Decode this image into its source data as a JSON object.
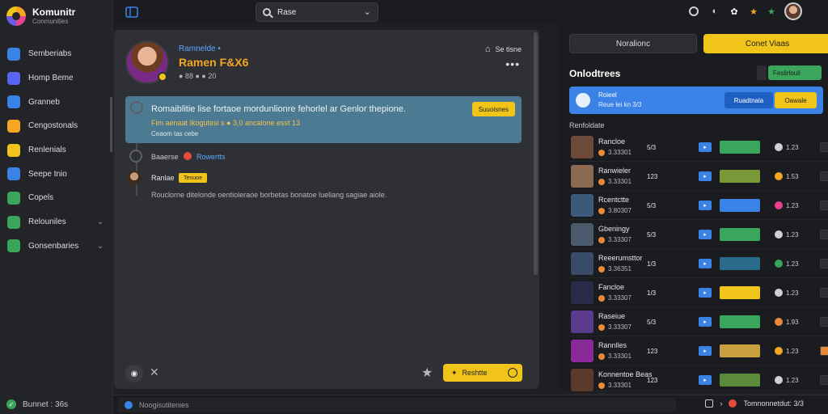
{
  "app": {
    "title": "Komunitr",
    "subtitle": "Conmunities"
  },
  "sidebar": {
    "items": [
      {
        "label": "Semberiabs",
        "icon": "chat-icon",
        "color": "#3b82e6",
        "chevron": false
      },
      {
        "label": "Homp Beme",
        "icon": "home-icon",
        "color": "#5865f2",
        "chevron": false
      },
      {
        "label": "Granneb",
        "icon": "star-icon",
        "color": "#3b82e6",
        "chevron": false
      },
      {
        "label": "Cengostonals",
        "icon": "folder-icon",
        "color": "#f5a623",
        "chevron": false
      },
      {
        "label": "Renlenials",
        "icon": "smile-icon",
        "color": "#f0c419",
        "chevron": false
      },
      {
        "label": "Seepe tnio",
        "icon": "info-icon",
        "color": "#3b82e6",
        "chevron": false
      },
      {
        "label": "Copels",
        "icon": "gamepad-icon",
        "color": "#3ba55c",
        "chevron": false
      },
      {
        "label": "Relouniles",
        "icon": "xbox-icon",
        "color": "#3ba55c",
        "chevron": true
      },
      {
        "label": "Gonsenbaries",
        "icon": "grid-icon",
        "color": "#3ba55c",
        "chevron": true
      }
    ],
    "footer": "Bunnet : 36s"
  },
  "topbar": {
    "search_value": "Rase"
  },
  "profile": {
    "name": "Ramnelde •",
    "handle": "Ramen F&X6",
    "meta": "● 88 ● ● 20"
  },
  "main": {
    "top_action": "Se tisne",
    "more": "•••",
    "highlight_title": "Romaiblitie lise fortaoe mordunlionre fehorlel ar Genlor thepione.",
    "highlight_sub": "Fim aenaat Ikogutesi s ● 3,0 ancalone esst 13",
    "highlight_sub2": "Ceaom tas cebe",
    "highlight_button": "Suuoisnes",
    "row1_label": "Baaerse",
    "row1_tag": "Rowertts",
    "commenter": "Ranlae",
    "commenter_tag": "Tenuoe",
    "comment": "Rouclorne ditelonde oentioleraoe borbetas bonatoe lueliang sagiae aiole.",
    "composer_button": "Reshtte"
  },
  "bottom": {
    "input": "Noogisutitenies",
    "right_text": "Tomnonnetdut: 3/3"
  },
  "right": {
    "tab1": "Noralionc",
    "tab2": "Conet Viaas",
    "title": "Onlodtrees",
    "ctrl": "Feslirlouli",
    "card_t1": "Roieel",
    "card_t2": "Reue lei kn 3/3",
    "card_b1": "Ruadtnala",
    "card_b2": "Oawale",
    "list_head": "Renfoldate",
    "rows": [
      {
        "name": "Rancloe",
        "meta": "3.33301",
        "num": "5/3",
        "thumb": "#6b4a3a",
        "strip": "#3ba55c",
        "rdot": "#cfd0d4",
        "rnum": "1.23",
        "rsq": "#2b2d31"
      },
      {
        "name": "Ranwieler",
        "meta": "3.33301",
        "num": "123",
        "thumb": "#8a6a50",
        "strip": "#7a9a3a",
        "rdot": "#f5a623",
        "rnum": "1.53",
        "rsq": "#2b2d31"
      },
      {
        "name": "Rcentctte",
        "meta": "3.80307",
        "num": "5/3",
        "thumb": "#3a5a7a",
        "strip": "#3b82e6",
        "rdot": "#e84393",
        "rnum": "1.23",
        "rsq": "#2b2d31"
      },
      {
        "name": "Gbeningy",
        "meta": "3.33307",
        "num": "5/3",
        "thumb": "#4a5a6a",
        "strip": "#3ba55c",
        "rdot": "#cfd0d4",
        "rnum": "1.23",
        "rsq": "#2b2d31"
      },
      {
        "name": "Reeerumsttor",
        "meta": "3.36351",
        "num": "1/3",
        "thumb": "#3a4a6a",
        "strip": "#2a6a8a",
        "rdot": "#3ba55c",
        "rnum": "1.23",
        "rsq": "#2b2d31"
      },
      {
        "name": "Fancloe",
        "meta": "3.33307",
        "num": "1/3",
        "thumb": "#2a2a4a",
        "strip": "#f0c419",
        "rdot": "#cfd0d4",
        "rnum": "1.23",
        "rsq": "#2b2d31"
      },
      {
        "name": "Raseiue",
        "meta": "3.33307",
        "num": "5/3",
        "thumb": "#5a3a8a",
        "strip": "#3ba55c",
        "rdot": "#e8893a",
        "rnum": "1.93",
        "rsq": "#2b2d31"
      },
      {
        "name": "Rannlles",
        "meta": "3.33301",
        "num": "123",
        "thumb": "#8a2a9a",
        "strip": "#c8a040",
        "rdot": "#f5a623",
        "rnum": "1.23",
        "rsq": "#e8893a"
      },
      {
        "name": "Konnentoe Beas",
        "meta": "3.33301",
        "num": "123",
        "thumb": "#5a3a2a",
        "strip": "#5a8a3a",
        "rdot": "#cfd0d4",
        "rnum": "1.23",
        "rsq": "#2b2d31"
      }
    ]
  }
}
